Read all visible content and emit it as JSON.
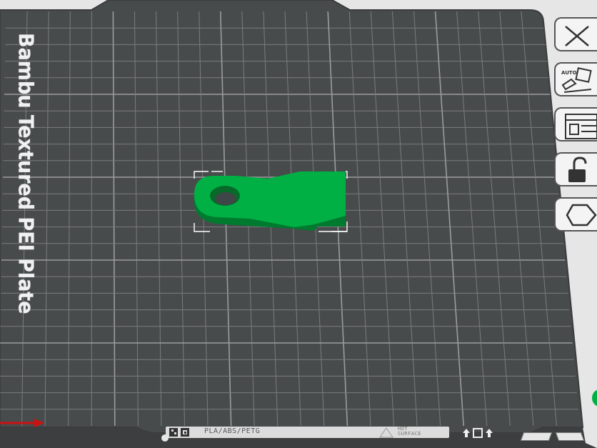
{
  "plate": {
    "name": "Bambu Textured PEI Plate",
    "filament_label": "PLA/ABS/PETG",
    "hot_surface_line1": "HOT",
    "hot_surface_line2": "SURFACE"
  },
  "object": {
    "color": "#00b045",
    "shade_color": "#007a2e"
  },
  "colors": {
    "plate": "#484b4c",
    "plate_border": "#3a3c3d",
    "grid": "#7a7d7e",
    "grid_major": "#9a9d9e",
    "background": "#e6e6e6",
    "x_axis": "#cc1111"
  },
  "side_tools": [
    {
      "name": "close-icon"
    },
    {
      "name": "auto-orient-icon"
    },
    {
      "name": "arrange-icon"
    },
    {
      "name": "lock-icon"
    },
    {
      "name": "plate-settings-icon"
    }
  ]
}
